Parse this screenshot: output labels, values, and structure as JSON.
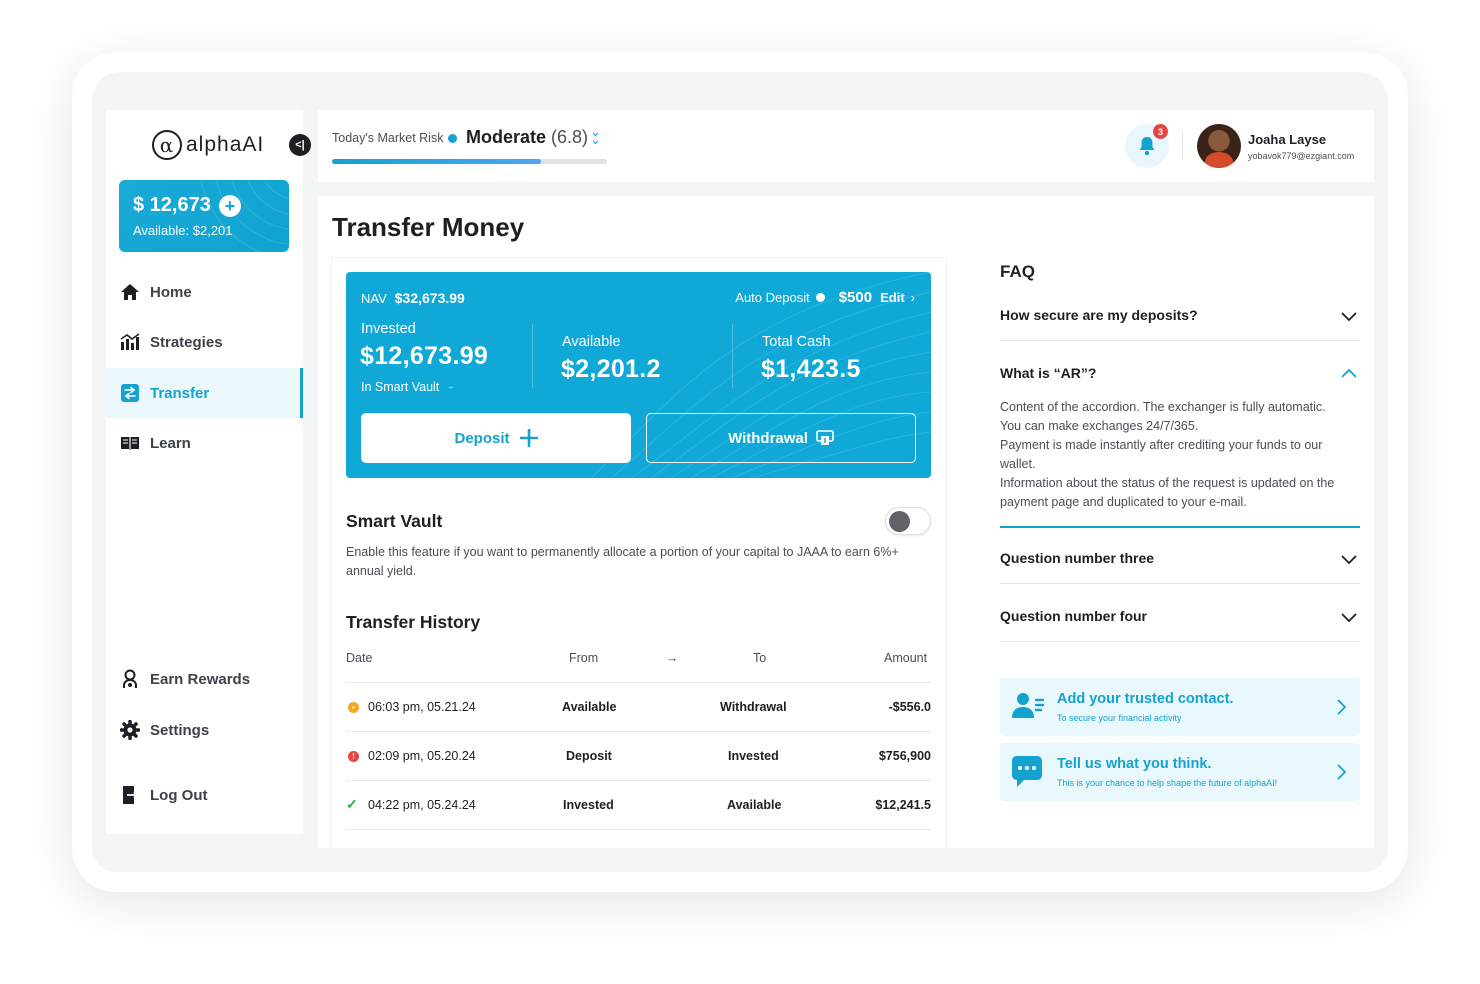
{
  "app": {
    "logo_text": "alphaAI",
    "logo_mark": "α"
  },
  "sidebar": {
    "balance": "$ 12,673",
    "available": "Available: $2,201",
    "items": [
      {
        "label": "Home",
        "icon": "home-icon"
      },
      {
        "label": "Strategies",
        "icon": "strategies-chart-icon"
      },
      {
        "label": "Transfer",
        "icon": "transfer-icon",
        "active": true
      },
      {
        "label": "Learn",
        "icon": "book-icon"
      }
    ],
    "bottom_items": [
      {
        "label": "Earn Rewards",
        "icon": "rewards-icon"
      },
      {
        "label": "Settings",
        "icon": "gear-icon"
      },
      {
        "label": "Log Out",
        "icon": "logout-icon"
      }
    ]
  },
  "header": {
    "risk_label": "Today's Market Risk",
    "risk_value": "Moderate",
    "risk_score": "(6.8)",
    "risk_level_fraction": 0.76,
    "notification_count": "3",
    "user_name": "Joaha Layse",
    "user_email": "yobavok779@ezgiant.com"
  },
  "page": {
    "title": "Transfer Money"
  },
  "account_card": {
    "nav_label": "NAV",
    "nav_value": "$32,673.99",
    "auto_deposit_label": "Auto Deposit",
    "auto_deposit_value": "$500",
    "edit_label": "Edit",
    "invested_label": "Invested",
    "invested_value": "$12,673.99",
    "smart_vault_label": "In Smart Vault",
    "smart_vault_value": "-",
    "available_label": "Available",
    "available_value": "$2,201.2",
    "total_cash_label": "Total Cash",
    "total_cash_value": "$1,423.5",
    "deposit_label": "Deposit",
    "withdrawal_label": "Withdrawal"
  },
  "smart_vault": {
    "title": "Smart Vault",
    "enabled": false,
    "description": "Enable this feature if you want to permanently allocate a portion of your capital to JAAA to earn 6%+ annual yield."
  },
  "history": {
    "title": "Transfer History",
    "headers": {
      "date": "Date",
      "from": "From",
      "arrow": "→",
      "to": "To",
      "amount": "Amount"
    },
    "rows": [
      {
        "status": "pending",
        "status_color": "#f5a623",
        "date": "06:03 pm, 05.21.24",
        "from": "Available",
        "to": "Withdrawal",
        "amount": "-$556.0"
      },
      {
        "status": "failed",
        "status_color": "#e64545",
        "date": "02:09 pm, 05.20.24",
        "from": "Deposit",
        "to": "Invested",
        "amount": "$756,900"
      },
      {
        "status": "completed",
        "status_color": "#22b14c",
        "date": "04:22 pm, 05.24.24",
        "from": "Invested",
        "to": "Available",
        "amount": "$12,241.5"
      }
    ]
  },
  "faq": {
    "title": "FAQ",
    "items": [
      {
        "question": "How secure are my deposits?",
        "expanded": false
      },
      {
        "question": "What is “AR”?",
        "expanded": true
      },
      {
        "question": "Question number three",
        "expanded": false
      },
      {
        "question": "Question number four",
        "expanded": false
      }
    ],
    "answer_lines": [
      "Content of the accordion. The exchanger is fully automatic.",
      "You can make exchanges 24/7/365.",
      "Payment is made instantly after crediting your funds to our wallet.",
      "Information about the status of the request is updated on the payment page and duplicated to your e-mail."
    ]
  },
  "promos": [
    {
      "title": "Add your trusted contact.",
      "subtitle": "To secure your financial activity",
      "icon": "contact-icon"
    },
    {
      "title": "Tell us what you think.",
      "subtitle": "This is your chance to help shape the future of alphaAI!",
      "icon": "chat-bubble-icon"
    }
  ],
  "colors": {
    "accent": "#16a2cf",
    "card": "#10a8d6",
    "active_bg": "#eaf8fc",
    "text": "#1d1f24"
  }
}
